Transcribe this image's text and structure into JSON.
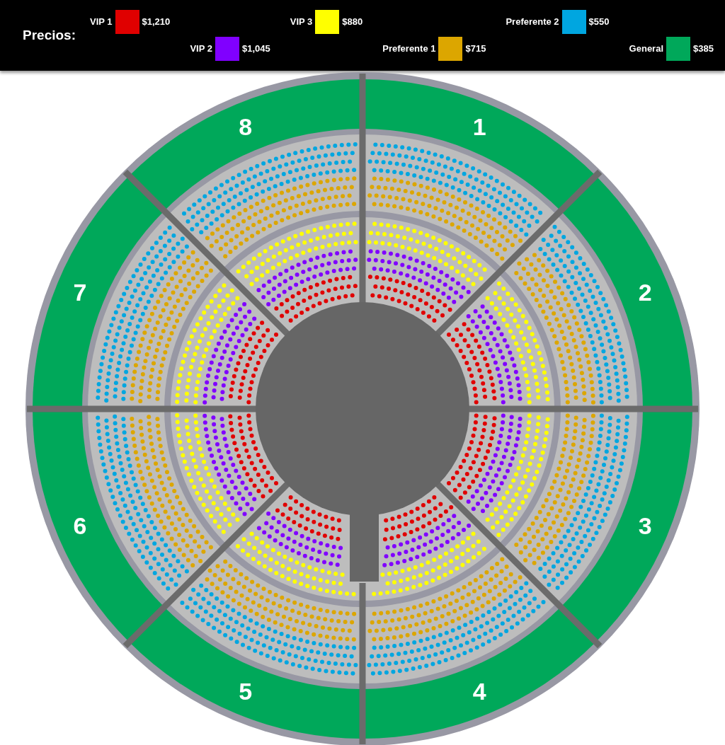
{
  "legend": {
    "title": "Precios:",
    "items": [
      {
        "label": "VIP 1",
        "price": "$1,210",
        "color": "#e00000"
      },
      {
        "label": "VIP 2",
        "price": "$1,045",
        "color": "#8000ff"
      },
      {
        "label": "VIP 3",
        "price": "$880",
        "color": "#ffff00"
      },
      {
        "label": "Preferente 1",
        "price": "$715",
        "color": "#dca600"
      },
      {
        "label": "Preferente 2",
        "price": "$550",
        "color": "#00a6e0"
      },
      {
        "label": "General",
        "price": "$385",
        "color": "#00a85a"
      }
    ]
  },
  "sections": [
    {
      "label": "1"
    },
    {
      "label": "2"
    },
    {
      "label": "3"
    },
    {
      "label": "4"
    },
    {
      "label": "5"
    },
    {
      "label": "6"
    },
    {
      "label": "7"
    },
    {
      "label": "8"
    }
  ]
}
